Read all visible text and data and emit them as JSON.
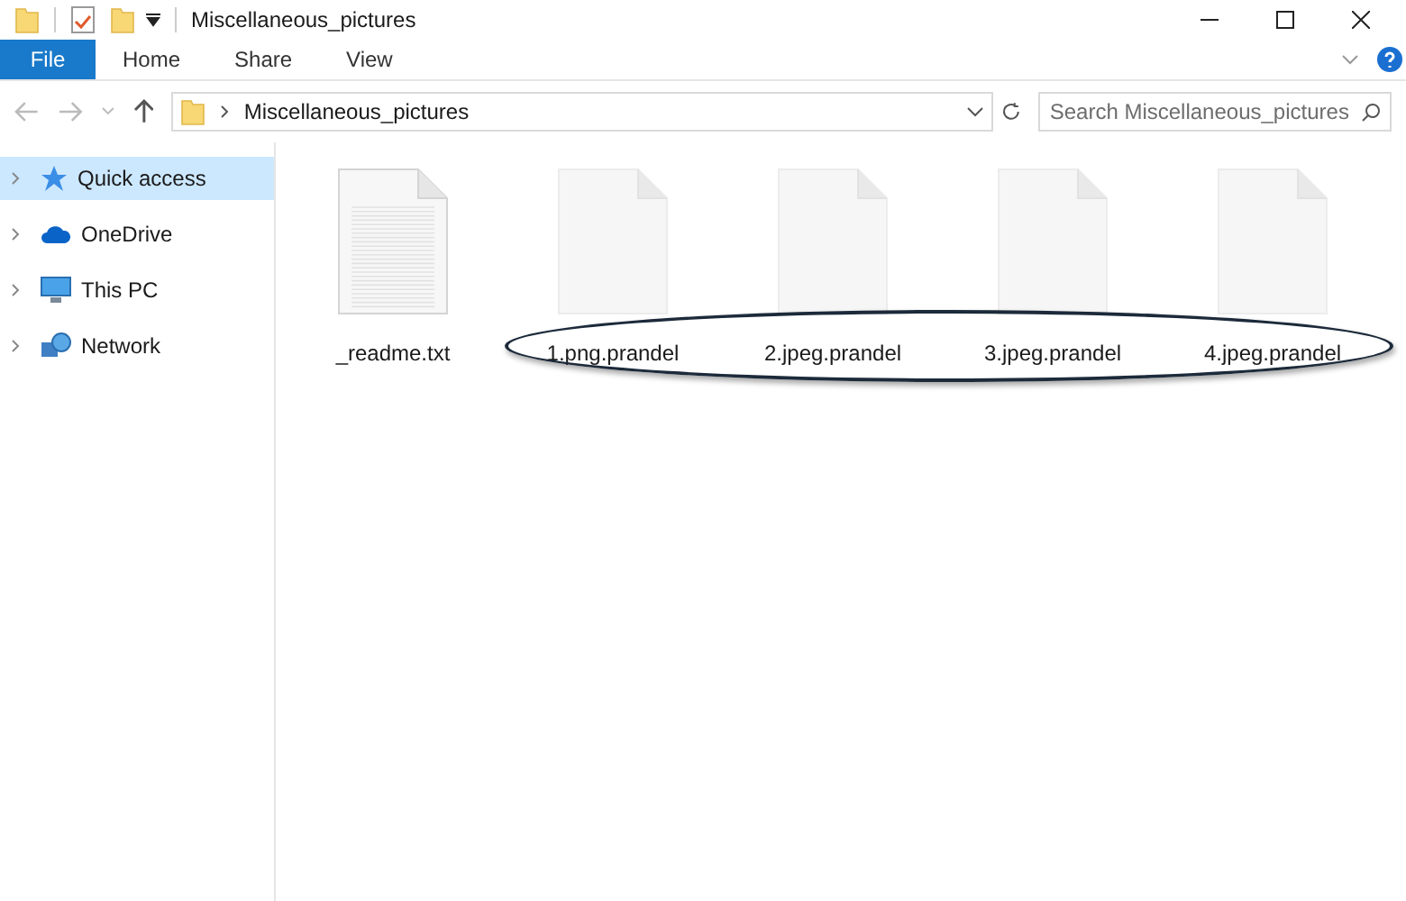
{
  "window": {
    "title": "Miscellaneous_pictures"
  },
  "ribbon_tabs": [
    {
      "label": "File",
      "selected": true
    },
    {
      "label": "Home",
      "selected": false
    },
    {
      "label": "Share",
      "selected": false
    },
    {
      "label": "View",
      "selected": false
    }
  ],
  "address_bar": {
    "path": "Miscellaneous_pictures"
  },
  "search": {
    "placeholder": "Search Miscellaneous_pictures"
  },
  "sidebar": {
    "items": [
      {
        "label": "Quick access",
        "kind": "star",
        "selected": true
      },
      {
        "label": "OneDrive",
        "kind": "cloud",
        "selected": false
      },
      {
        "label": "This PC",
        "kind": "pc",
        "selected": false
      },
      {
        "label": "Network",
        "kind": "network",
        "selected": false
      }
    ]
  },
  "files": [
    {
      "name": "_readme.txt",
      "kind": "text"
    },
    {
      "name": "1.png.prandel",
      "kind": "blank"
    },
    {
      "name": "2.jpeg.prandel",
      "kind": "blank"
    },
    {
      "name": "3.jpeg.prandel",
      "kind": "blank"
    },
    {
      "name": "4.jpeg.prandel",
      "kind": "blank"
    }
  ]
}
